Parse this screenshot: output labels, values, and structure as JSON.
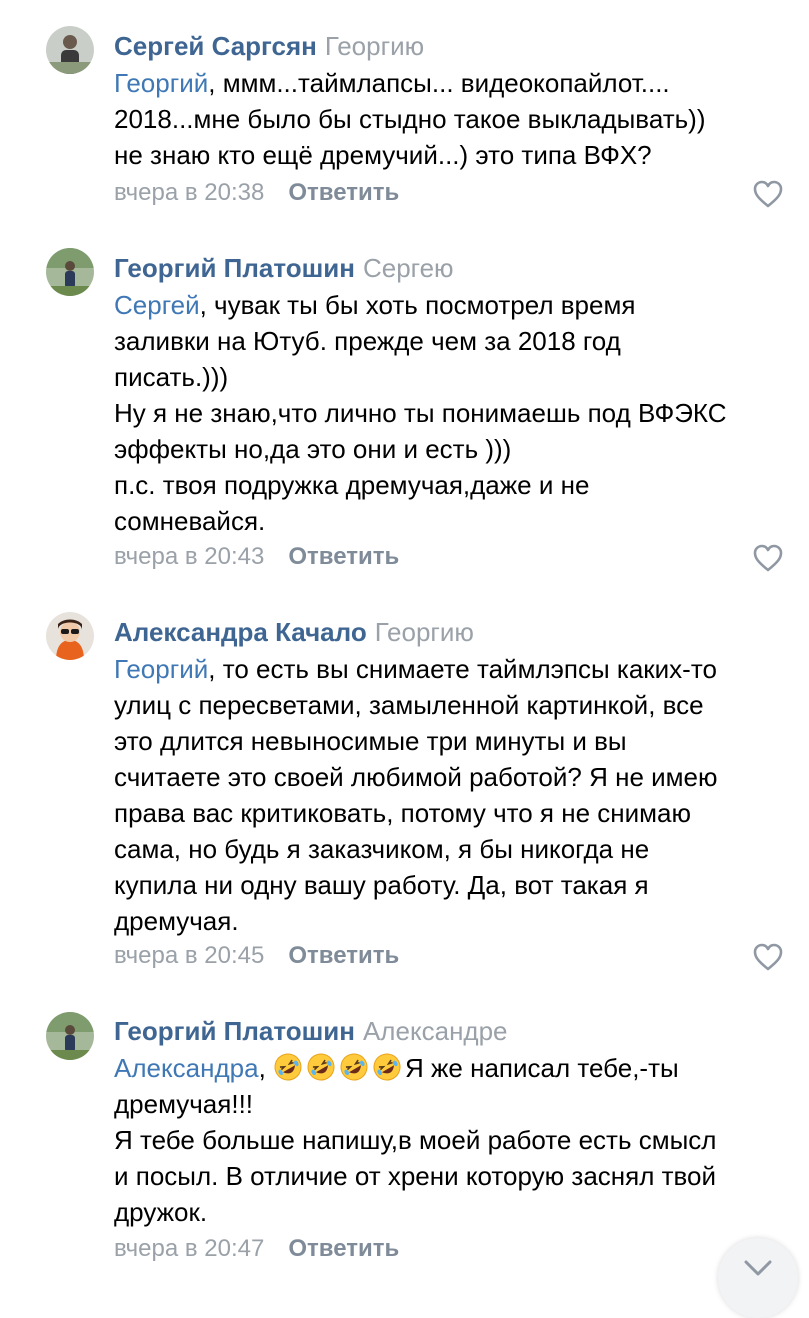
{
  "comments": [
    {
      "author": "Сергей Саргсян",
      "reply_to": "Георгию",
      "mention": "Георгий",
      "text": ", ммм...таймлапсы... видеокопайлот....\n2018...мне было бы стыдно такое выкладывать))\nне знаю кто ещё дремучий...) это типа ВФХ?",
      "time": "вчера в 20:38",
      "reply_label": "Ответить"
    },
    {
      "author": "Георгий Платошин",
      "reply_to": "Сергею",
      "mention": "Сергей",
      "text": ", чувак ты бы хоть посмотрел время\nзаливки на Ютуб. прежде чем за 2018 год\nписать.)))\nНу я не знаю,что лично ты понимаешь под ВФЭКС\nэффекты но,да это они и есть )))\nп.с. твоя подружка дремучая,даже и не\nсомневайся.",
      "time": "вчера в 20:43",
      "reply_label": "Ответить"
    },
    {
      "author": "Александра Качало",
      "reply_to": "Георгию",
      "mention": "Георгий",
      "text": ", то есть вы снимаете таймлэпсы каких-то\nулиц с пересветами, замыленной картинкой, все\nэто длится невыносимые три минуты и вы\nсчитаете это своей любимой работой? Я не имею\nправа вас критиковать, потому что я не снимаю\nсама, но будь я заказчиком, я бы никогда не\nкупила ни одну вашу работу. Да, вот такая я\nдремучая.",
      "time": "вчера в 20:45",
      "reply_label": "Ответить"
    },
    {
      "author": "Георгий Платошин",
      "reply_to": "Александре",
      "mention": "Александра",
      "text_after_emoji": "Я же написал тебе,-ты",
      "text": "дремучая!!!\nЯ тебе больше напишу,в моей работе есть смысл\nи посыл. В отличие от хрени которую заснял твой\nдружок.",
      "time": "вчера в 20:47",
      "reply_label": "Ответить"
    }
  ],
  "icons": {
    "like": "heart-outline-icon",
    "emoji": "rolling-on-floor-laughing-emoji",
    "scroll": "chevron-down-icon"
  },
  "colors": {
    "author": "#3f6692",
    "mention": "#3f78b5",
    "meta": "#9aa1a8",
    "reply": "#7f8b98"
  }
}
